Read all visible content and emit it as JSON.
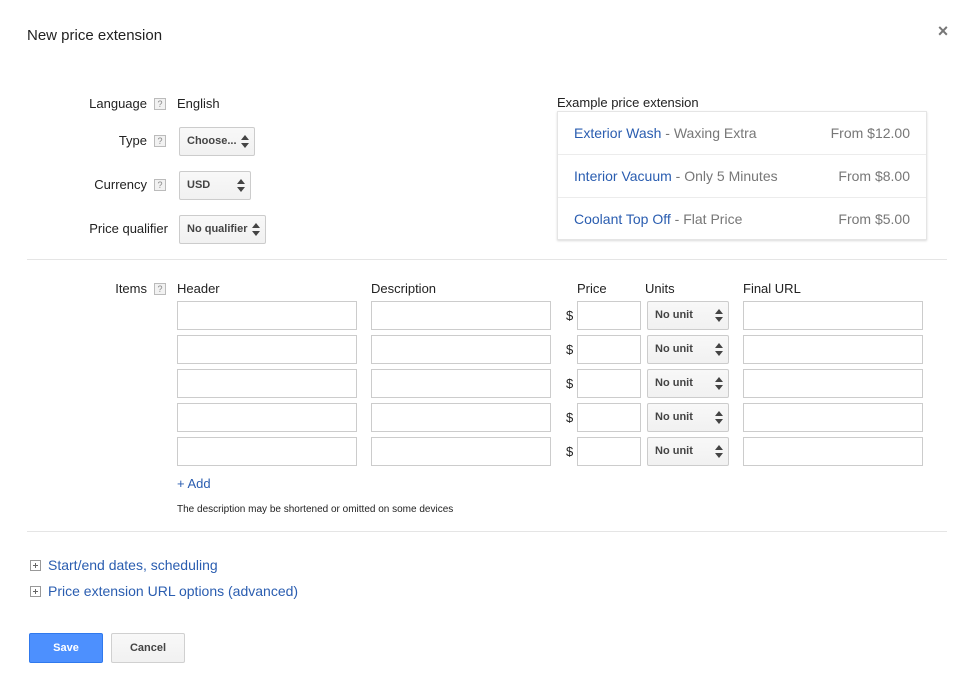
{
  "dialog": {
    "title": "New price extension",
    "close_icon": "close-icon"
  },
  "form": {
    "language": {
      "label": "Language",
      "value": "English"
    },
    "type": {
      "label": "Type",
      "selected": "Choose..."
    },
    "currency": {
      "label": "Currency",
      "selected": "USD"
    },
    "price_qualifier": {
      "label": "Price qualifier",
      "selected": "No qualifier"
    },
    "help_glyph": "?"
  },
  "example": {
    "title": "Example price extension",
    "rows": [
      {
        "header": "Exterior Wash",
        "separator": " - ",
        "description": "Waxing Extra",
        "price": "From $12.00"
      },
      {
        "header": "Interior Vacuum",
        "separator": " - ",
        "description": "Only 5 Minutes",
        "price": "From $8.00"
      },
      {
        "header": "Coolant Top Off",
        "separator": " - ",
        "description": "Flat Price",
        "price": "From $5.00"
      }
    ]
  },
  "items": {
    "label": "Items",
    "columns": {
      "header": "Header",
      "description": "Description",
      "price": "Price",
      "units": "Units",
      "final_url": "Final URL"
    },
    "currency_symbol": "$",
    "rows": [
      {
        "header": "",
        "description": "",
        "price": "",
        "unit": "No unit",
        "final_url": ""
      },
      {
        "header": "",
        "description": "",
        "price": "",
        "unit": "No unit",
        "final_url": ""
      },
      {
        "header": "",
        "description": "",
        "price": "",
        "unit": "No unit",
        "final_url": ""
      },
      {
        "header": "",
        "description": "",
        "price": "",
        "unit": "No unit",
        "final_url": ""
      },
      {
        "header": "",
        "description": "",
        "price": "",
        "unit": "No unit",
        "final_url": ""
      }
    ],
    "add_label": "+ Add",
    "note": "The description may be shortened or omitted on some devices"
  },
  "expanders": {
    "scheduling": "Start/end dates, scheduling",
    "url_options": "Price extension URL options (advanced)"
  },
  "actions": {
    "save": "Save",
    "cancel": "Cancel"
  },
  "colors": {
    "link": "#2a5db0",
    "primary_button": "#4d90fe"
  }
}
